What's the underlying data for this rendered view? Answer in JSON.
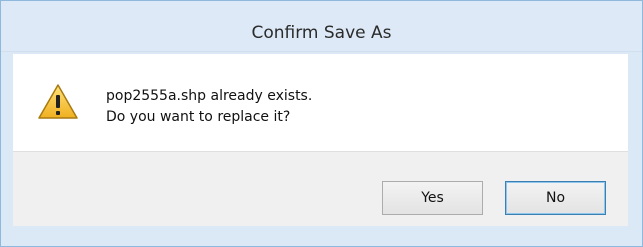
{
  "dialog": {
    "title": "Confirm Save As",
    "icon": "warning-icon",
    "message_line1": "pop2555a.shp already exists.",
    "message_line2": "Do you want to replace it?",
    "buttons": {
      "yes_label": "Yes",
      "no_label": "No"
    }
  },
  "colors": {
    "titlebar": "#dde9f6",
    "frame_border": "#8fb8dd",
    "warning_fill": "#f6c12b",
    "default_button_border": "#3c7fb1"
  }
}
